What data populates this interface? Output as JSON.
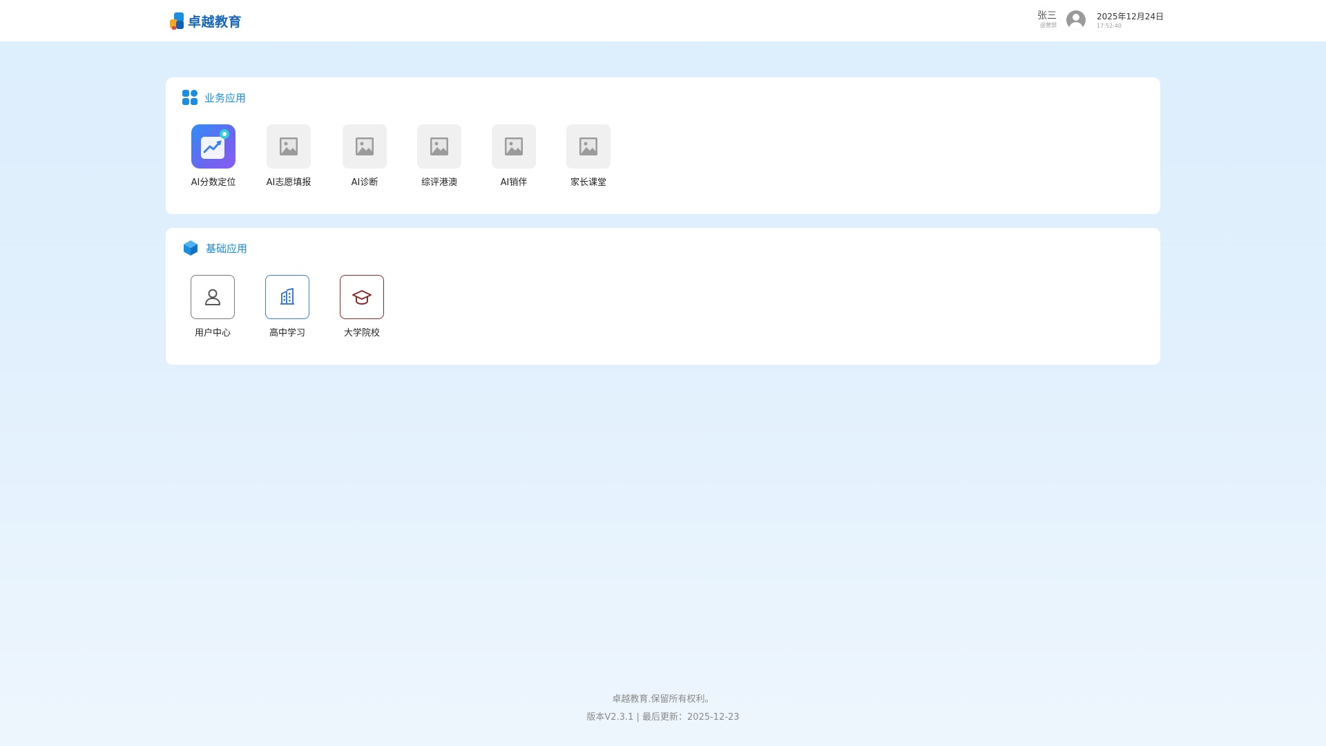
{
  "header": {
    "logo_text": "卓越教育",
    "user_name": "张三",
    "user_dept": "运营部",
    "date": "2025年12月24日",
    "time": "17:52:40"
  },
  "sections": [
    {
      "title": "业务应用",
      "icon": "apps-grid-icon",
      "apps": [
        {
          "label": "AI分数定位",
          "icon": "ai-score-position-icon"
        },
        {
          "label": "AI志愿填报",
          "icon": "image-placeholder-icon"
        },
        {
          "label": "AI诊断",
          "icon": "image-placeholder-icon"
        },
        {
          "label": "综评港澳",
          "icon": "image-placeholder-icon"
        },
        {
          "label": "AI销伴",
          "icon": "image-placeholder-icon"
        },
        {
          "label": "家长课堂",
          "icon": "image-placeholder-icon"
        }
      ]
    },
    {
      "title": "基础应用",
      "icon": "cube-icon",
      "apps": [
        {
          "label": "用户中心",
          "icon": "user-icon",
          "color": "#555555"
        },
        {
          "label": "高中学习",
          "icon": "building-icon",
          "color": "#3a7bd5"
        },
        {
          "label": "大学院校",
          "icon": "graduation-cap-icon",
          "color": "#8b2a2a"
        }
      ]
    }
  ],
  "footer": {
    "copyright": "卓越教育.保留所有权利。",
    "version": "版本V2.3.1 | 最后更新：2025-12-23"
  },
  "colors": {
    "accent": "#1a8ee0",
    "page_bg": "#dcedfc"
  }
}
